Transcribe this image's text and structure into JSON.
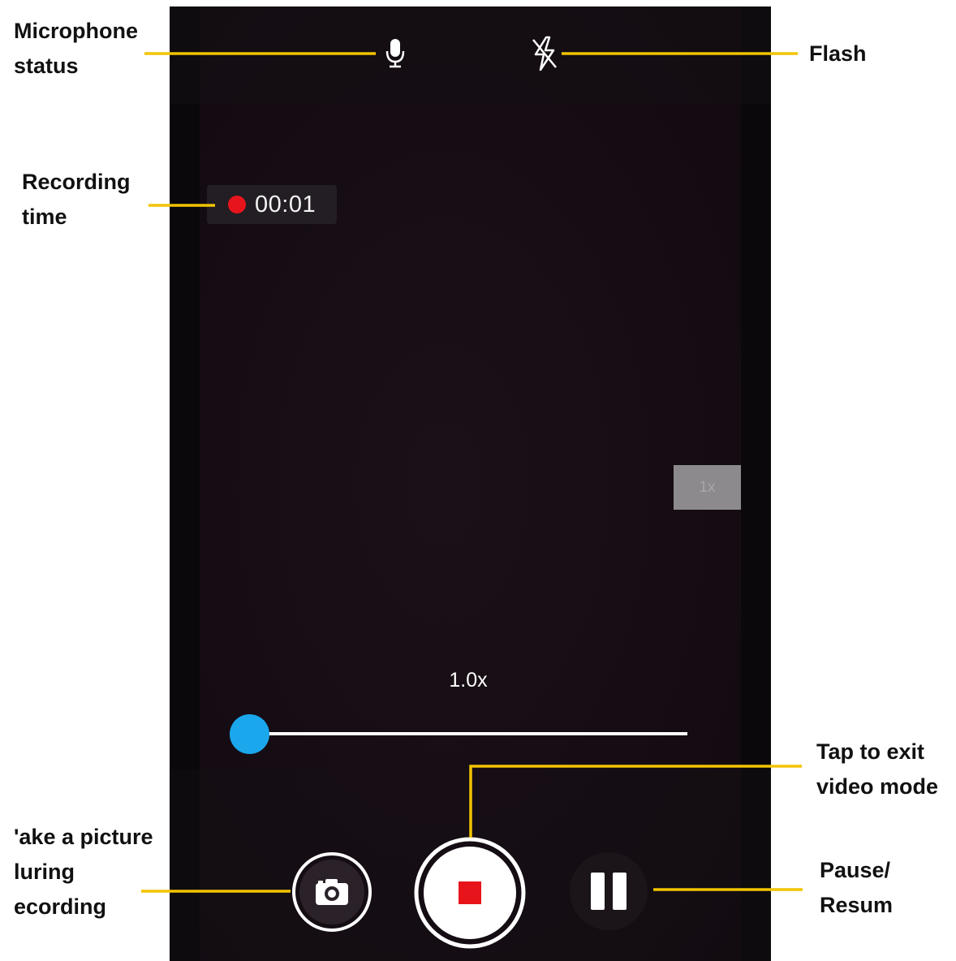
{
  "camera": {
    "recording_time": "00:01",
    "zoom_level": "1.0x",
    "zoom_chip_label": "1x",
    "zoom_fraction": 0.0
  },
  "icons": {
    "microphone": "microphone-icon",
    "flash_off": "flash-off-icon",
    "camera": "camera-icon",
    "stop": "stop-icon",
    "pause": "pause-icon",
    "recording_dot": "recording-dot-icon"
  },
  "annotations": {
    "microphone_line1": "Microphone",
    "microphone_line2": "status",
    "flash": "Flash",
    "recording_line1": "Recording",
    "recording_line2": "time",
    "exit_line1": "Tap to exit",
    "exit_line2": "video mode",
    "picture_line1": "'ake a picture",
    "picture_line2": "luring",
    "picture_line3": "ecording",
    "pause_line1": "Pause/",
    "pause_line2": "Resum"
  },
  "colors": {
    "leader_line": "#f2c400",
    "record_red": "#e8141b",
    "slider_thumb": "#1aa7ec"
  }
}
